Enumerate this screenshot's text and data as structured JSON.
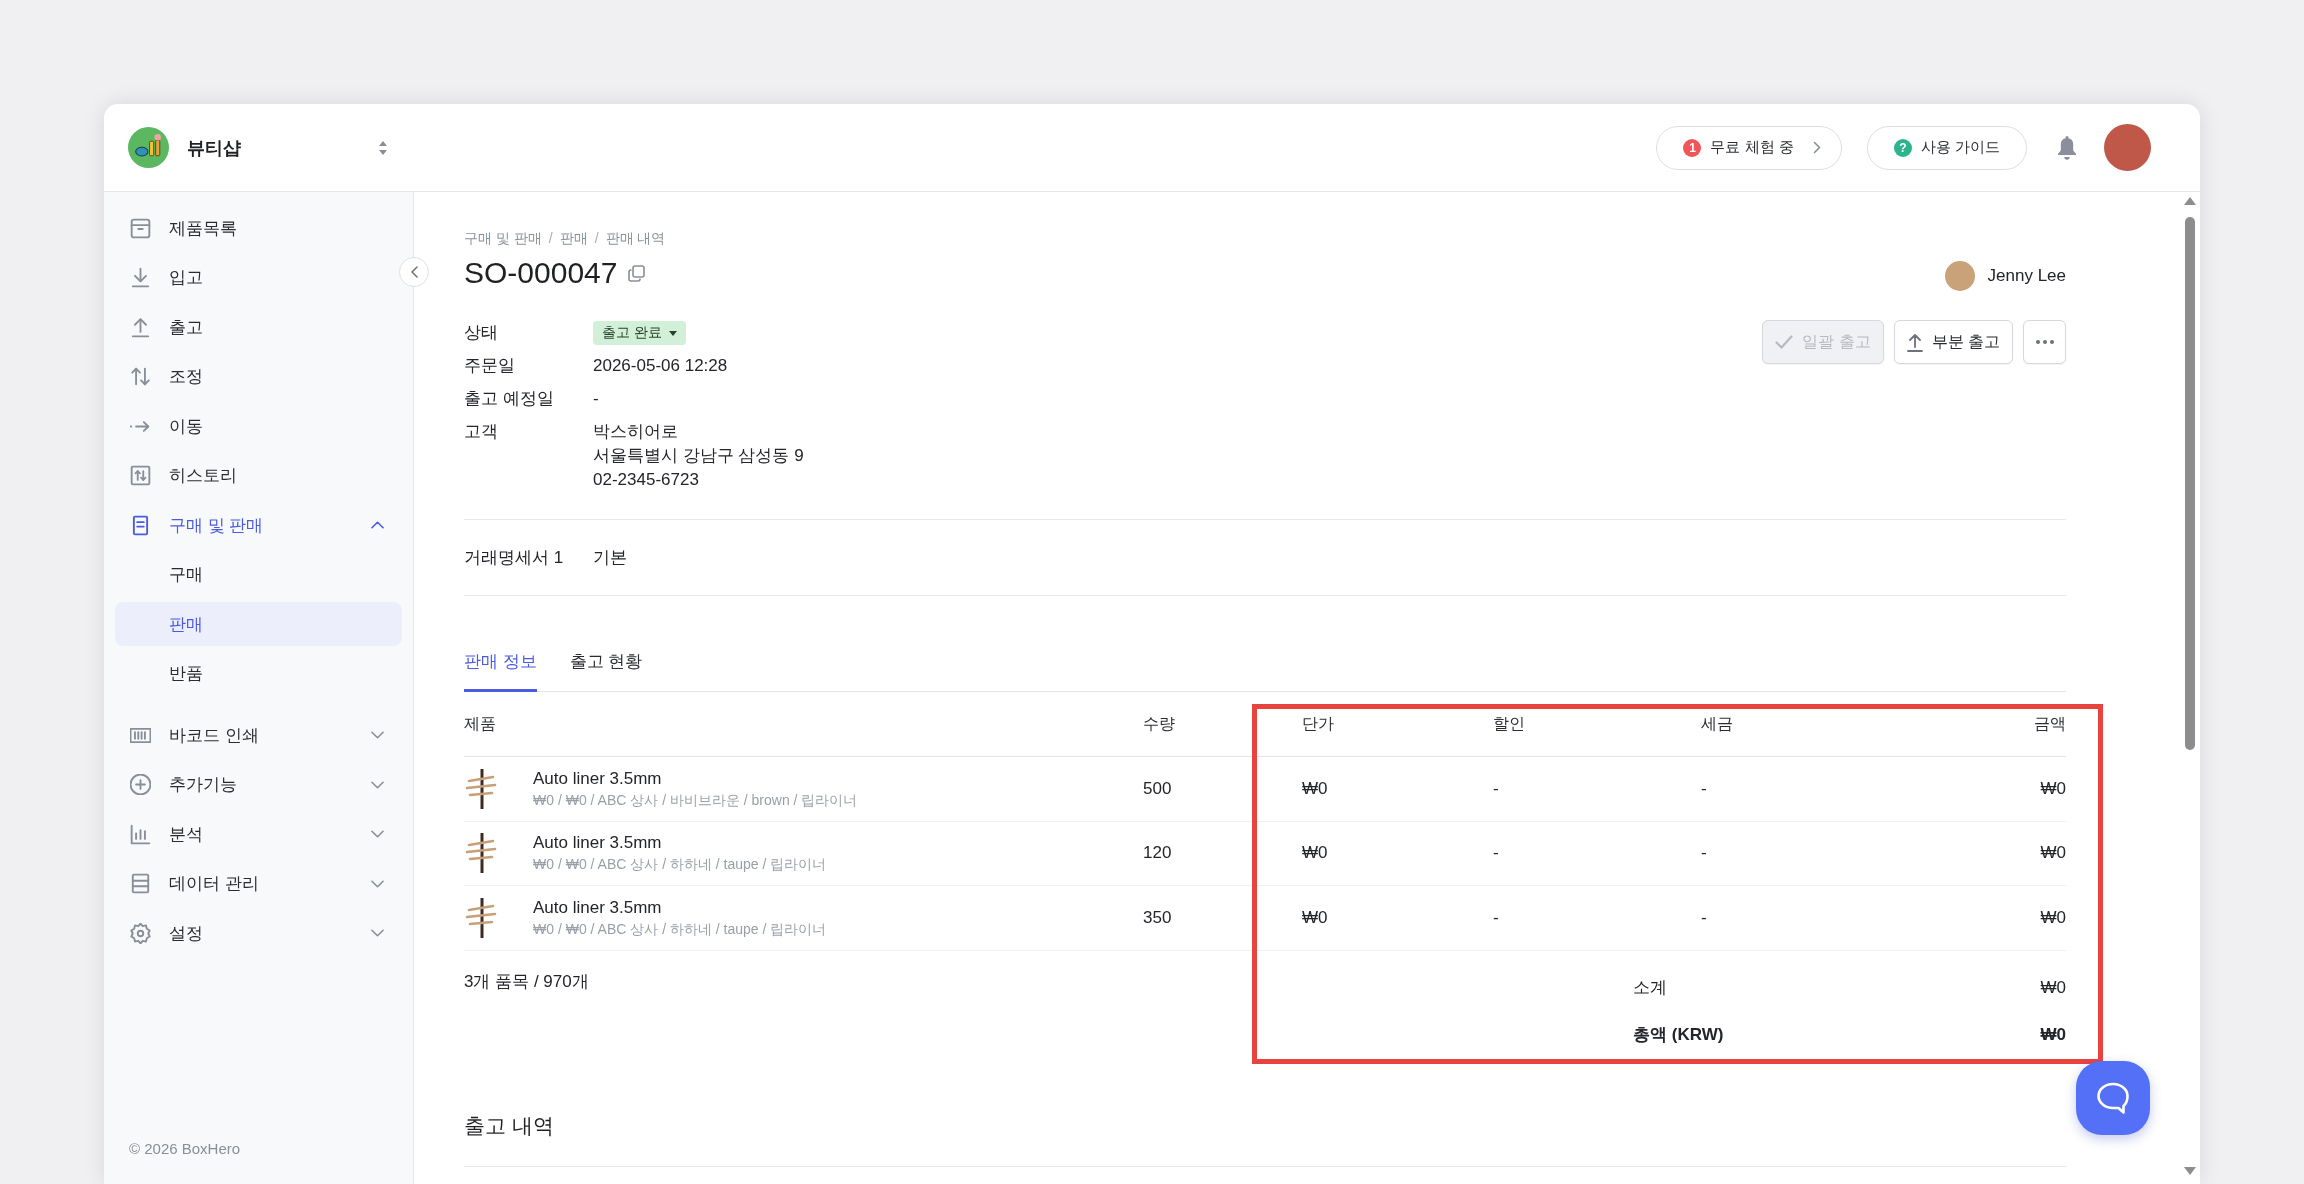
{
  "top_bar": {
    "workspace": "뷰티샵",
    "trial": {
      "badge": "1",
      "label": "무료 체험 중"
    },
    "guide": {
      "badge": "?",
      "label": "사용 가이드"
    }
  },
  "sidebar": {
    "items": [
      {
        "label": "제품목록",
        "selected": false
      },
      {
        "label": "입고",
        "selected": false
      },
      {
        "label": "출고",
        "selected": false
      },
      {
        "label": "조정",
        "selected": false
      },
      {
        "label": "이동",
        "selected": false
      },
      {
        "label": "히스토리",
        "selected": false
      },
      {
        "label": "구매 및 판매",
        "selected": true,
        "expanded": true,
        "children": [
          {
            "label": "구매",
            "selected": false
          },
          {
            "label": "판매",
            "selected": true
          },
          {
            "label": "반품",
            "selected": false
          }
        ]
      },
      {
        "label": "바코드 인쇄",
        "selected": false,
        "expanded": false
      },
      {
        "label": "추가기능",
        "selected": false,
        "expanded": false
      },
      {
        "label": "분석",
        "selected": false,
        "expanded": false
      },
      {
        "label": "데이터 관리",
        "selected": false,
        "expanded": false
      },
      {
        "label": "설정",
        "selected": false,
        "expanded": false
      }
    ],
    "copyright": "© 2026 BoxHero"
  },
  "order": {
    "breadcrumb": [
      {
        "kind": "link",
        "label": "구매 및 판매"
      },
      {
        "kind": "separator",
        "label": "/"
      },
      {
        "kind": "link",
        "label": "판매"
      },
      {
        "kind": "separator",
        "label": "/"
      },
      {
        "kind": "link",
        "label": "판매 내역"
      }
    ],
    "number": "SO-000047",
    "assignee": "Jenny Lee"
  },
  "actions": [
    {
      "kind": "check",
      "label": "일괄 출고",
      "disabled": true
    },
    {
      "kind": "upload",
      "label": "부분 출고",
      "disabled": false
    },
    {
      "kind": "more",
      "disabled": false
    }
  ],
  "details": [
    {
      "label": "상태",
      "kind": "status",
      "value": "출고 완료"
    },
    {
      "label": "주문일",
      "kind": "text",
      "value": "2026-05-06 12:28"
    },
    {
      "label": "출고 예정일",
      "kind": "text",
      "value": "-"
    },
    {
      "label": "고객",
      "kind": "lines",
      "lines": [
        "박스히어로",
        "서울특별시 강남구 삼성동 9",
        "02-2345-6723"
      ]
    }
  ],
  "documents": [
    {
      "label": "거래명세서 1",
      "value": "기본"
    }
  ],
  "tabs": [
    {
      "label": "판매 정보",
      "selected": true
    },
    {
      "label": "출고 현황",
      "selected": false
    }
  ],
  "table": {
    "columns": [
      "제품",
      "수량",
      "단가",
      "할인",
      "세금",
      "금액"
    ],
    "rows": [
      {
        "product": "Auto liner 3.5mm",
        "details": "₩0 / ₩0 / ABC 상사 / 바비브라운 / brown / 립라이너",
        "quantity": "500",
        "unit_price": "₩0",
        "discount": "-",
        "tax": "-",
        "amount": "₩0"
      },
      {
        "product": "Auto liner 3.5mm",
        "details": "₩0 / ₩0 / ABC 상사 / 하하네 / taupe / 립라이너",
        "quantity": "120",
        "unit_price": "₩0",
        "discount": "-",
        "tax": "-",
        "amount": "₩0"
      },
      {
        "product": "Auto liner 3.5mm",
        "details": "₩0 / ₩0 / ABC 상사 / 하하네 / taupe / 립라이너",
        "quantity": "350",
        "unit_price": "₩0",
        "discount": "-",
        "tax": "-",
        "amount": "₩0"
      }
    ],
    "footer": "3개 품목 / 970개",
    "subtotal": {
      "label": "소계",
      "value": "₩0"
    },
    "total": {
      "label": "총액 (KRW)",
      "value": "₩0"
    },
    "price_columns_highlighted": true
  },
  "shipments": {
    "title": "출고 내역"
  }
}
